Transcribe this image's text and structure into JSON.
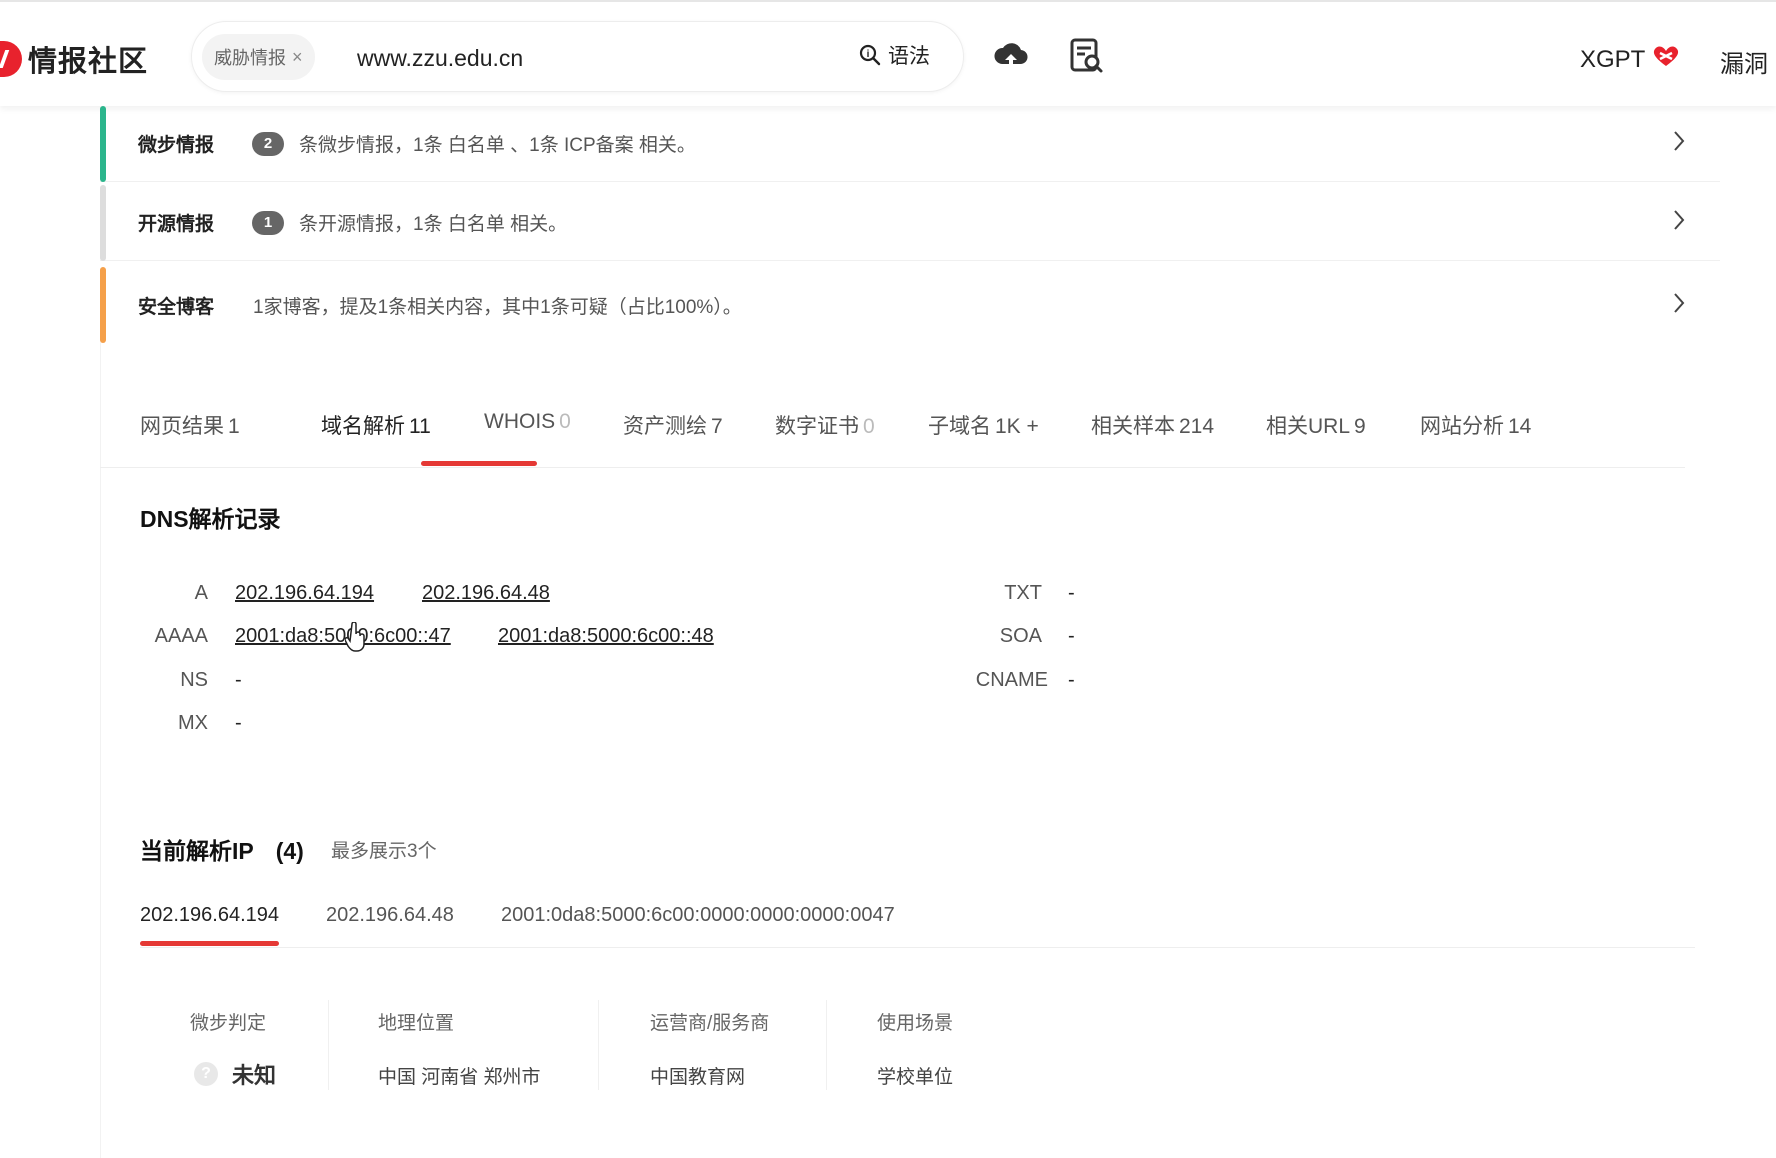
{
  "header": {
    "logo_text": "情报社区",
    "scope_pill": "威胁情报",
    "search_value": "www.zzu.edu.cn",
    "syntax_label": "语法",
    "xgpt_label": "XGPT",
    "vuln_label": "漏洞"
  },
  "intel_rows": [
    {
      "title": "微步情报",
      "count": "2",
      "desc": "条微步情报，1条 白名单 、1条 ICP备案 相关。",
      "color": "#2bb58c"
    },
    {
      "title": "开源情报",
      "count": "1",
      "desc": "条开源情报，1条 白名单 相关。",
      "color": "#dddddd"
    },
    {
      "title": "安全博客",
      "count": "",
      "desc": "1家博客，提及1条相关内容，其中1条可疑（占比100%）。",
      "color": "#f5a04a"
    }
  ],
  "tabs": [
    {
      "label": "网页结果",
      "num": "1"
    },
    {
      "label": "域名解析",
      "num": "11"
    },
    {
      "label": "WHOIS",
      "num": "0"
    },
    {
      "label": "资产测绘",
      "num": "7"
    },
    {
      "label": "数字证书",
      "num": "0"
    },
    {
      "label": "子域名",
      "num": "1K +"
    },
    {
      "label": "相关样本",
      "num": "214"
    },
    {
      "label": "相关URL",
      "num": "9"
    },
    {
      "label": "网站分析",
      "num": "14"
    }
  ],
  "dns": {
    "title": "DNS解析记录",
    "records": {
      "A": [
        "202.196.64.194",
        "202.196.64.48"
      ],
      "AAAA": [
        "2001:da8:5000:6c00::47",
        "2001:da8:5000:6c00::48"
      ],
      "NS": "-",
      "MX": "-",
      "TXT": "-",
      "SOA": "-",
      "CNAME": "-"
    },
    "labels": {
      "a": "A",
      "aaaa": "AAAA",
      "ns": "NS",
      "mx": "MX",
      "txt": "TXT",
      "soa": "SOA",
      "cname": "CNAME"
    }
  },
  "current_ip": {
    "title": "当前解析IP",
    "count": "(4)",
    "note": "最多展示3个",
    "ips": [
      "202.196.64.194",
      "202.196.64.48",
      "2001:0da8:5000:6c00:0000:0000:0000:0047"
    ],
    "columns": {
      "verdict_head": "微步判定",
      "verdict": "未知",
      "geo_head": "地理位置",
      "geo": "中国 河南省 郑州市",
      "isp_head": "运营商/服务商",
      "isp": "中国教育网",
      "usage_head": "使用场景",
      "usage": "学校单位"
    }
  },
  "colors": {
    "accent": "#e53935",
    "brand": "#e8222d"
  }
}
